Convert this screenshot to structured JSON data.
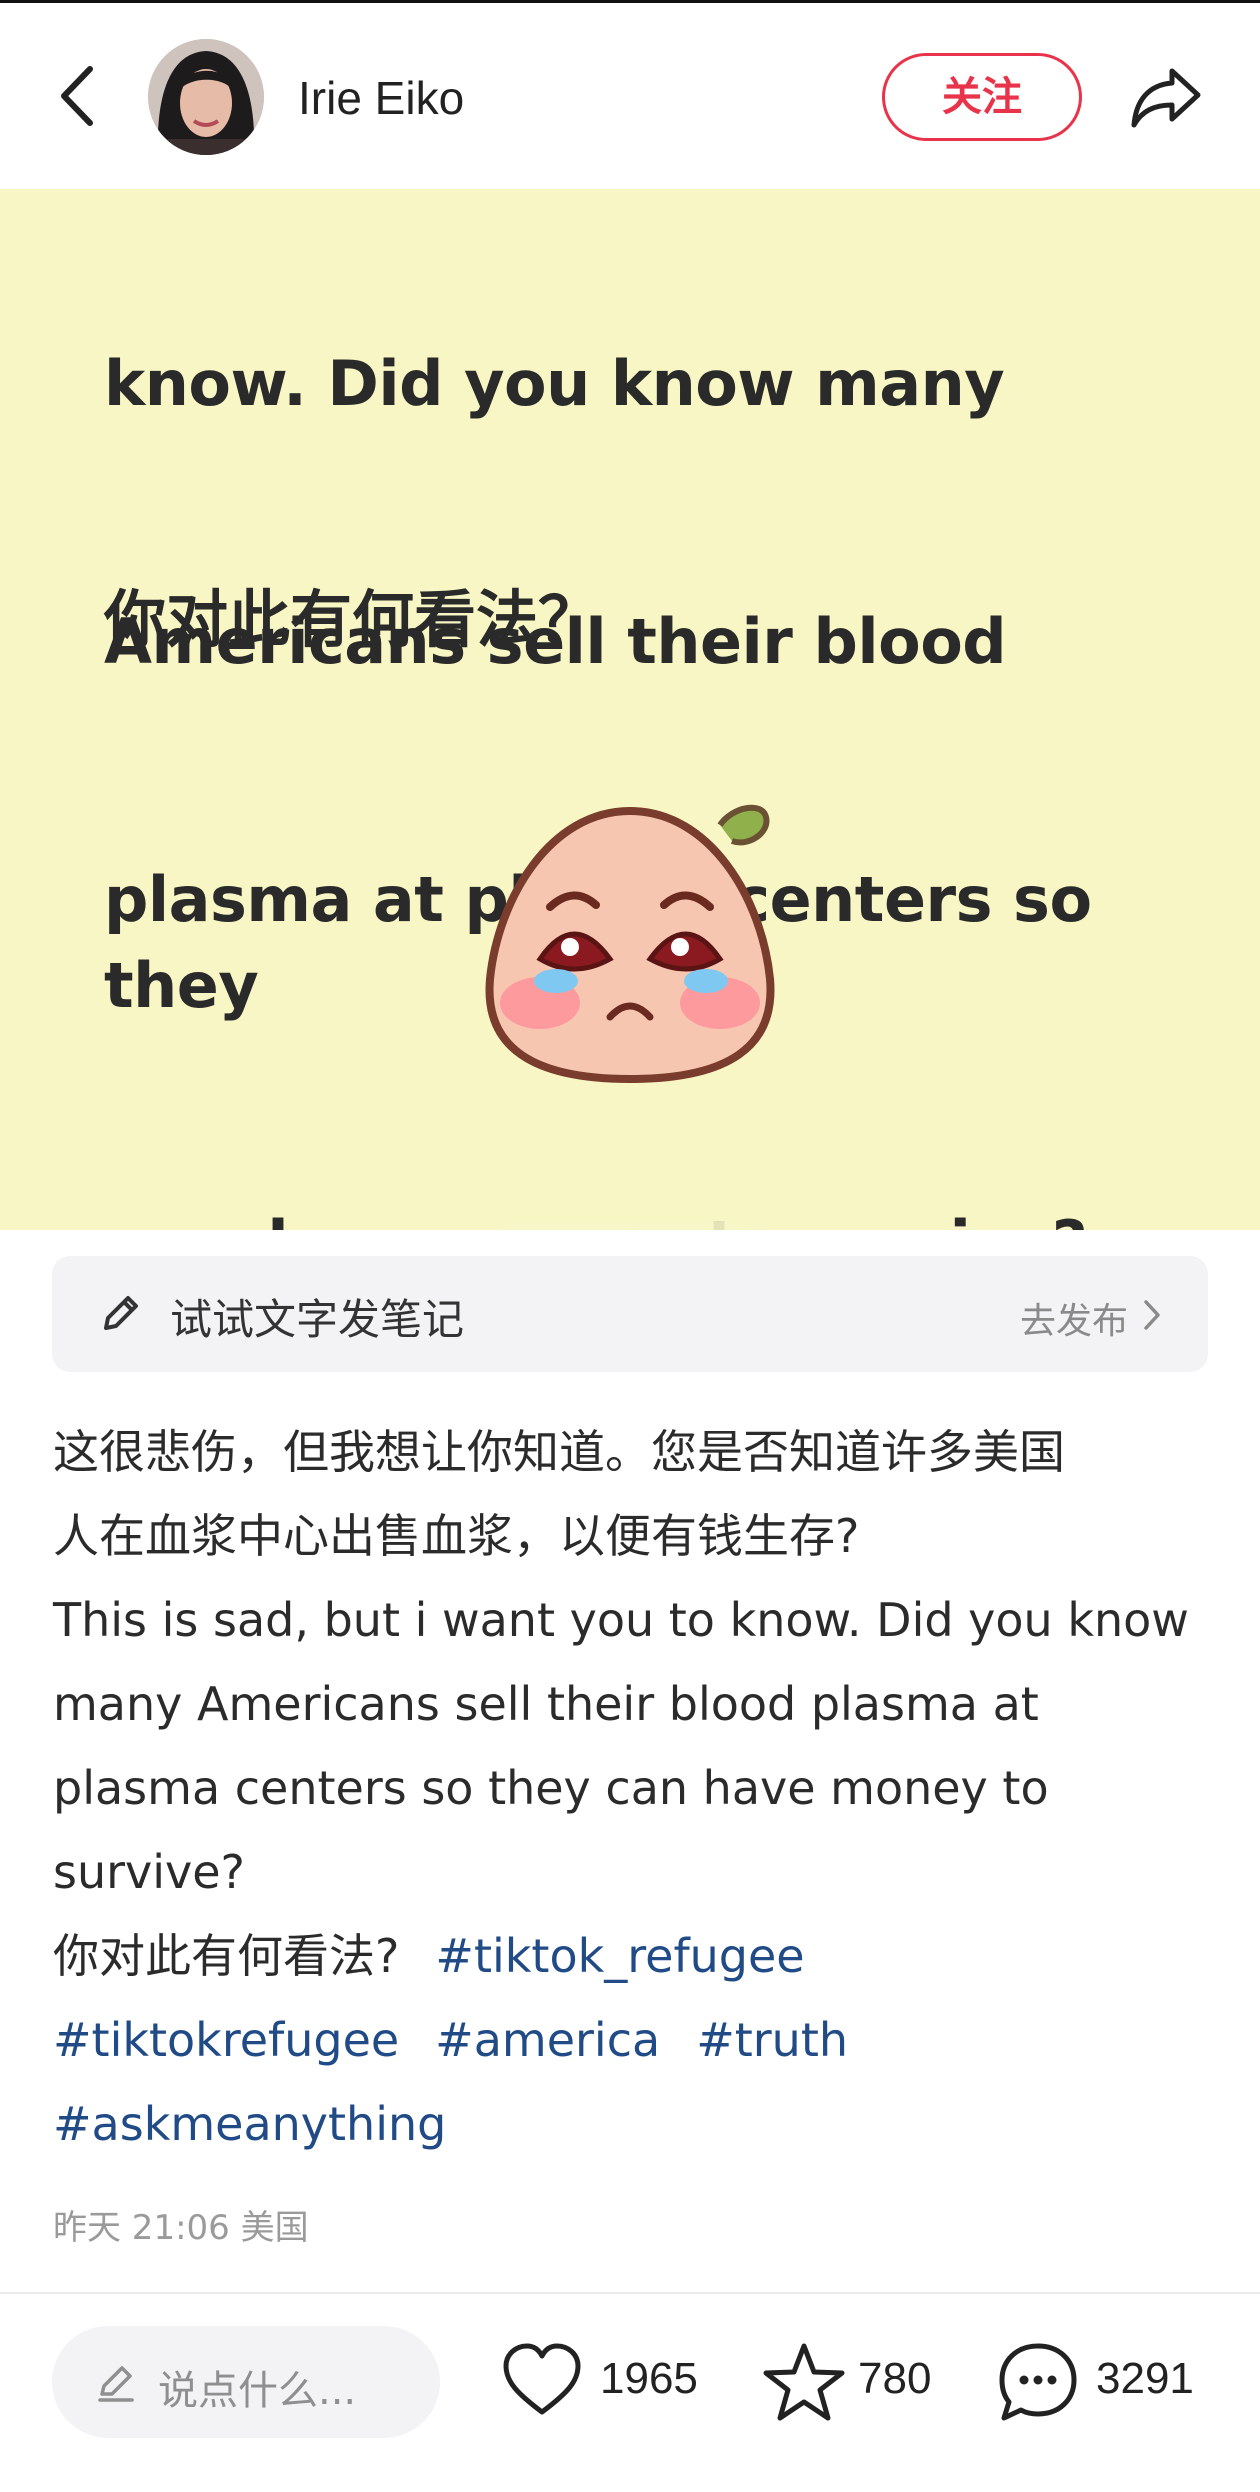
{
  "header": {
    "author_name": "Irie Eiko",
    "follow_label": "关注"
  },
  "image_card": {
    "text_lines": [
      "know. Did you know many",
      "Americans sell their blood",
      "plasma at plasma centers so they",
      " can have money to survive?"
    ],
    "question": "你对此有何看法？"
  },
  "prompt_bar": {
    "label": "试试文字发笔记",
    "action": "去发布"
  },
  "post": {
    "lines": [
      "这很悲伤，但我想让你知道。您是否知道许多美国",
      "人在血浆中心出售血浆，以便有钱生存?",
      "This is sad, but i want you to know. Did you know",
      "many Americans sell their blood plasma at",
      "plasma centers so they can have money to",
      "survive?"
    ],
    "question": "你对此有何看法?",
    "tags": [
      "#tiktok_refugee",
      "#tiktokrefugee",
      "#america",
      "#truth",
      "#askmeanything"
    ],
    "timestamp": "昨天 21:06 美国"
  },
  "bottom_bar": {
    "comment_placeholder": "说点什么...",
    "likes": "1965",
    "collects": "780",
    "comments": "3291"
  },
  "colors": {
    "accent": "#e8334a",
    "image_bg": "#f7f6c4",
    "tag": "#214b86"
  },
  "icons": [
    "chevron-left-icon",
    "share-icon",
    "pencil-icon",
    "chevron-right-icon",
    "heart-icon",
    "star-icon",
    "comment-bubble-icon"
  ]
}
